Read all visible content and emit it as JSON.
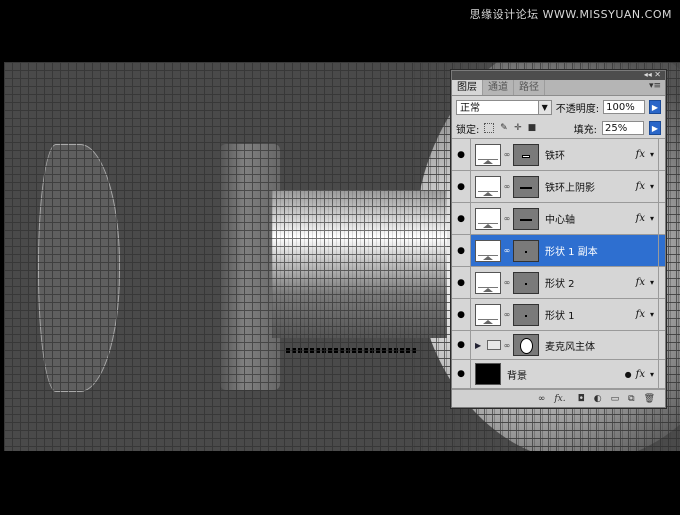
{
  "watermark": "思缘设计论坛 WWW.MISSYUAN.COM",
  "panel": {
    "collapse_glyph": "◂◂ ✕",
    "tabs": [
      {
        "label": "图层",
        "active": true
      },
      {
        "label": "通道",
        "active": false
      },
      {
        "label": "路径",
        "active": false
      }
    ],
    "menu_glyph": "▾≡",
    "blend_mode": "正常",
    "opacity_label": "不透明度:",
    "opacity_value": "100%",
    "lock_label": "锁定:",
    "fill_label": "填充:",
    "fill_value": "25%",
    "layers": [
      {
        "name": "铁环",
        "mask": "minus",
        "fx": "fx",
        "selected": false
      },
      {
        "name": "铁环上阴影",
        "mask": "line",
        "fx": "fx",
        "selected": false
      },
      {
        "name": "中心轴",
        "mask": "line",
        "fx": "fx",
        "selected": false
      },
      {
        "name": "形状 1 副本",
        "mask": "dot",
        "fx": "",
        "selected": true
      },
      {
        "name": "形状 2",
        "mask": "dot",
        "fx": "fx",
        "selected": false
      },
      {
        "name": "形状 1",
        "mask": "dot",
        "fx": "fx",
        "selected": false
      }
    ],
    "group_layer": {
      "name": "麦克风主体"
    },
    "background_layer": {
      "name": "背景",
      "fx": "fx"
    },
    "bottom_fx": "fx."
  }
}
